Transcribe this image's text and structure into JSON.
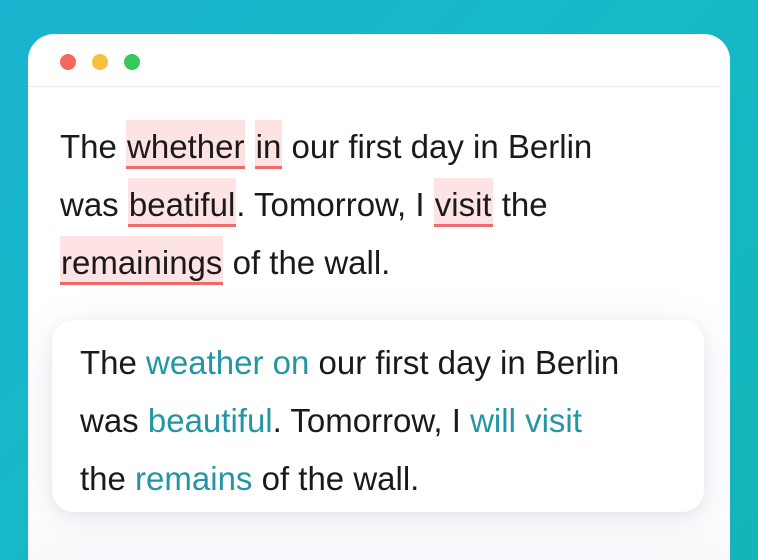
{
  "window": {
    "controls": [
      "close",
      "minimize",
      "maximize"
    ],
    "colors": {
      "close": "#f26a5e",
      "minimize": "#f6bf3d",
      "maximize": "#37c85a"
    }
  },
  "original": {
    "segments": [
      {
        "text": "The ",
        "error": false
      },
      {
        "text": "whether",
        "error": true
      },
      {
        "text": " ",
        "error": false
      },
      {
        "text": "in",
        "error": true
      },
      {
        "text": " our first day in Berlin was ",
        "error": false
      },
      {
        "text": "beatiful",
        "error": true
      },
      {
        "text": ". Tomorrow, I ",
        "error": false
      },
      {
        "text": "visit",
        "error": true
      },
      {
        "text": " the ",
        "error": false
      },
      {
        "text": "remainings",
        "error": true
      },
      {
        "text": " of the wall.",
        "error": false
      }
    ]
  },
  "corrected": {
    "segments": [
      {
        "text": "The ",
        "fix": false
      },
      {
        "text": "weather on",
        "fix": true
      },
      {
        "text": " our first day in Berlin was ",
        "fix": false
      },
      {
        "text": "beautiful",
        "fix": true
      },
      {
        "text": ". Tomorrow, I ",
        "fix": false
      },
      {
        "text": "will visit",
        "fix": true
      },
      {
        "text": " the ",
        "fix": false
      },
      {
        "text": "remains",
        "fix": true
      },
      {
        "text": " of the wall.",
        "fix": false
      }
    ]
  },
  "colors": {
    "background": "#16b9c6",
    "error_highlight": "#fde3e3",
    "error_underline": "#ef6a6a",
    "fix_text": "#2396a3"
  }
}
